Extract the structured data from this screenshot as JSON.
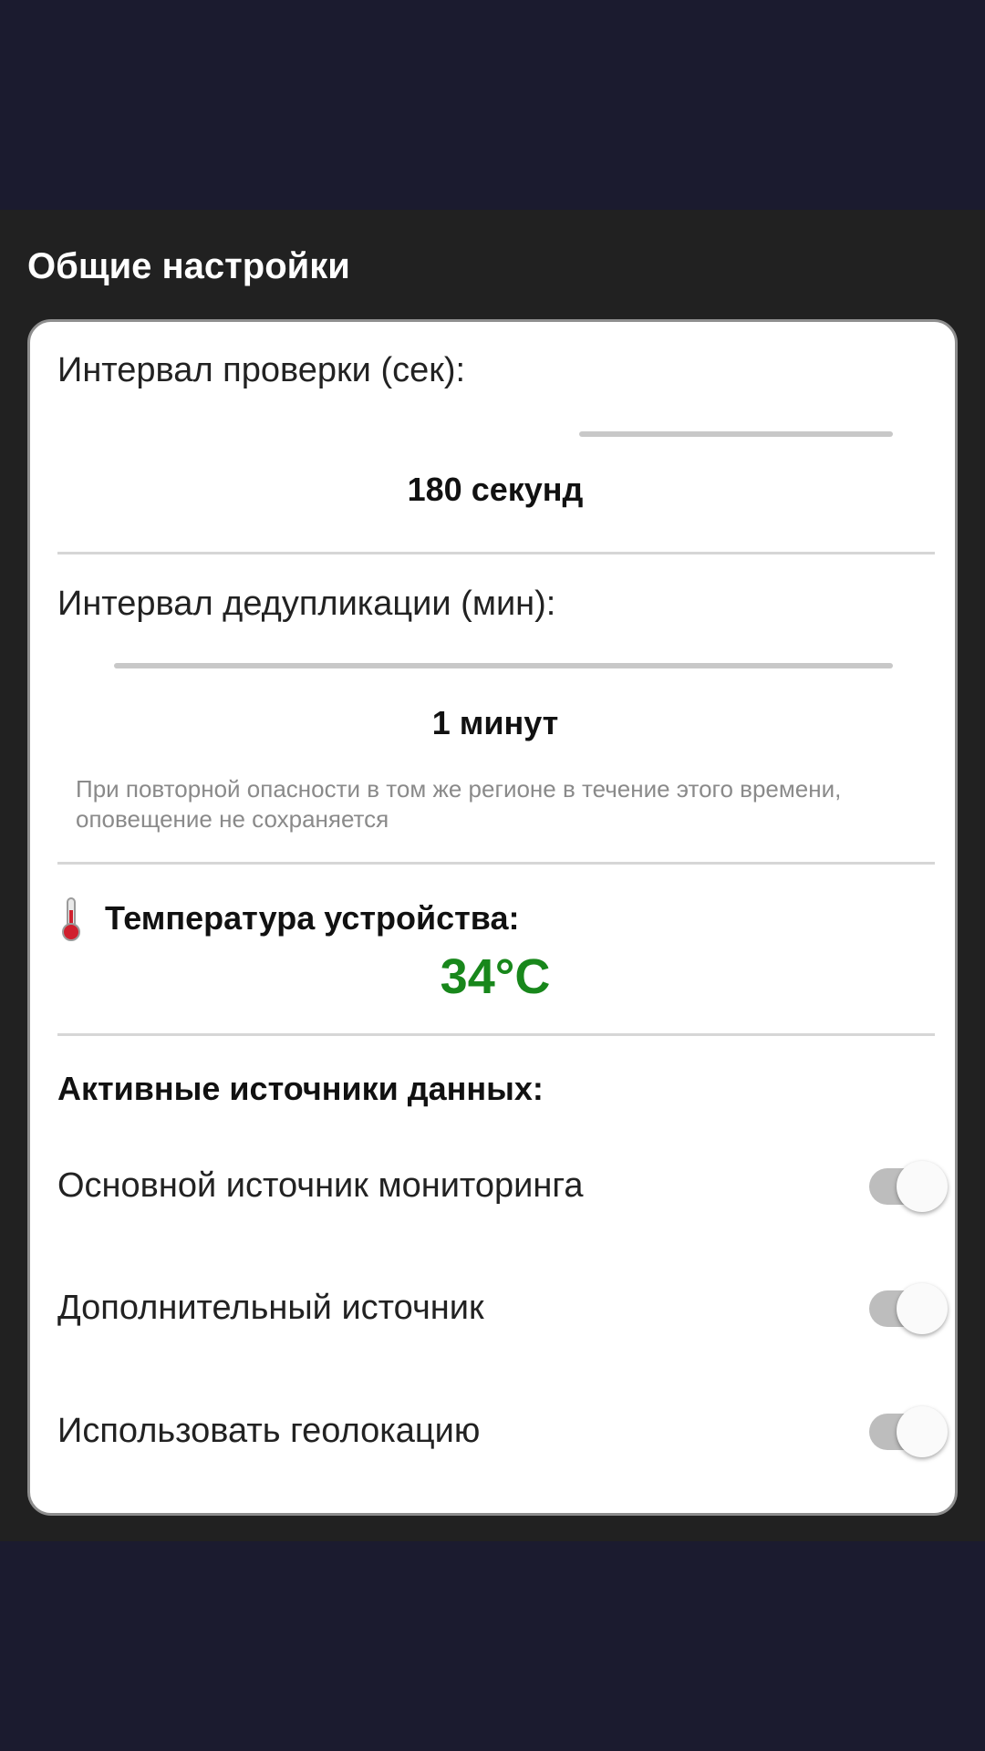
{
  "settings": {
    "title": "Общие настройки",
    "check_interval": {
      "label": "Интервал проверки (сек):",
      "value_text": "180 секунд"
    },
    "dedup_interval": {
      "label": "Интервал дедупликации (мин):",
      "value_text": "1 минут",
      "hint": "При повторной опасности в том же регионе в течение этого времени, оповещение не сохраняется"
    },
    "temperature": {
      "icon": "thermometer-icon",
      "label": "Температура устройства:",
      "value": "34°C",
      "value_color": "#18871b"
    },
    "sources": {
      "title": "Активные источники данных:",
      "items": [
        {
          "label": "Основной источник мониторинга",
          "enabled": false
        },
        {
          "label": "Дополнительный источник",
          "enabled": false
        },
        {
          "label": "Использовать геолокацию",
          "enabled": false
        }
      ]
    }
  },
  "colors": {
    "screen_background": "#1b1b2f",
    "panel_background": "#212121",
    "card_background": "#ffffff"
  }
}
